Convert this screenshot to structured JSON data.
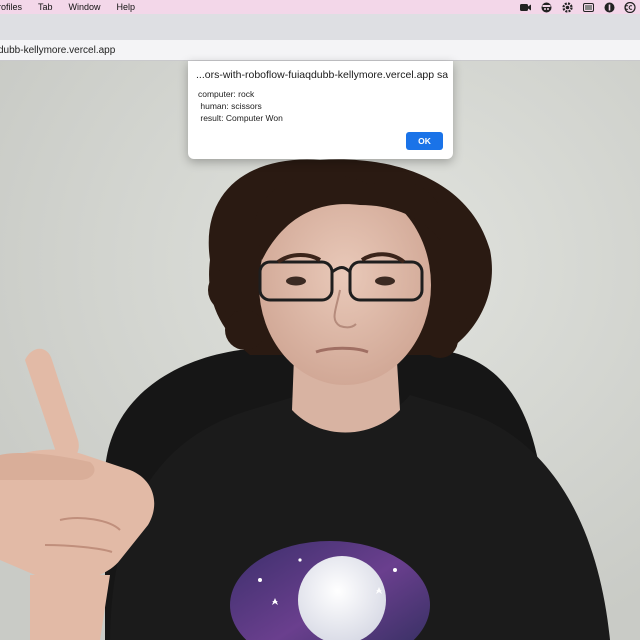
{
  "menubar": {
    "items": [
      "rofiles",
      "Tab",
      "Window",
      "Help"
    ],
    "tray_icons": [
      "camera-icon",
      "pirate-icon",
      "gear-icon",
      "window-icon",
      "info-icon",
      "cc-icon"
    ]
  },
  "browser": {
    "url": "dubb-kellymore.vercel.app"
  },
  "alert": {
    "title": "...ors-with-roboflow-fuiaqdubb-kellymore.vercel.app says",
    "lines": [
      "computer: rock",
      " human: scissors",
      " result: Computer Won"
    ],
    "ok_label": "OK",
    "accent": "#1a73e8"
  },
  "webcam": {
    "description_icon": "webcam-feed"
  }
}
